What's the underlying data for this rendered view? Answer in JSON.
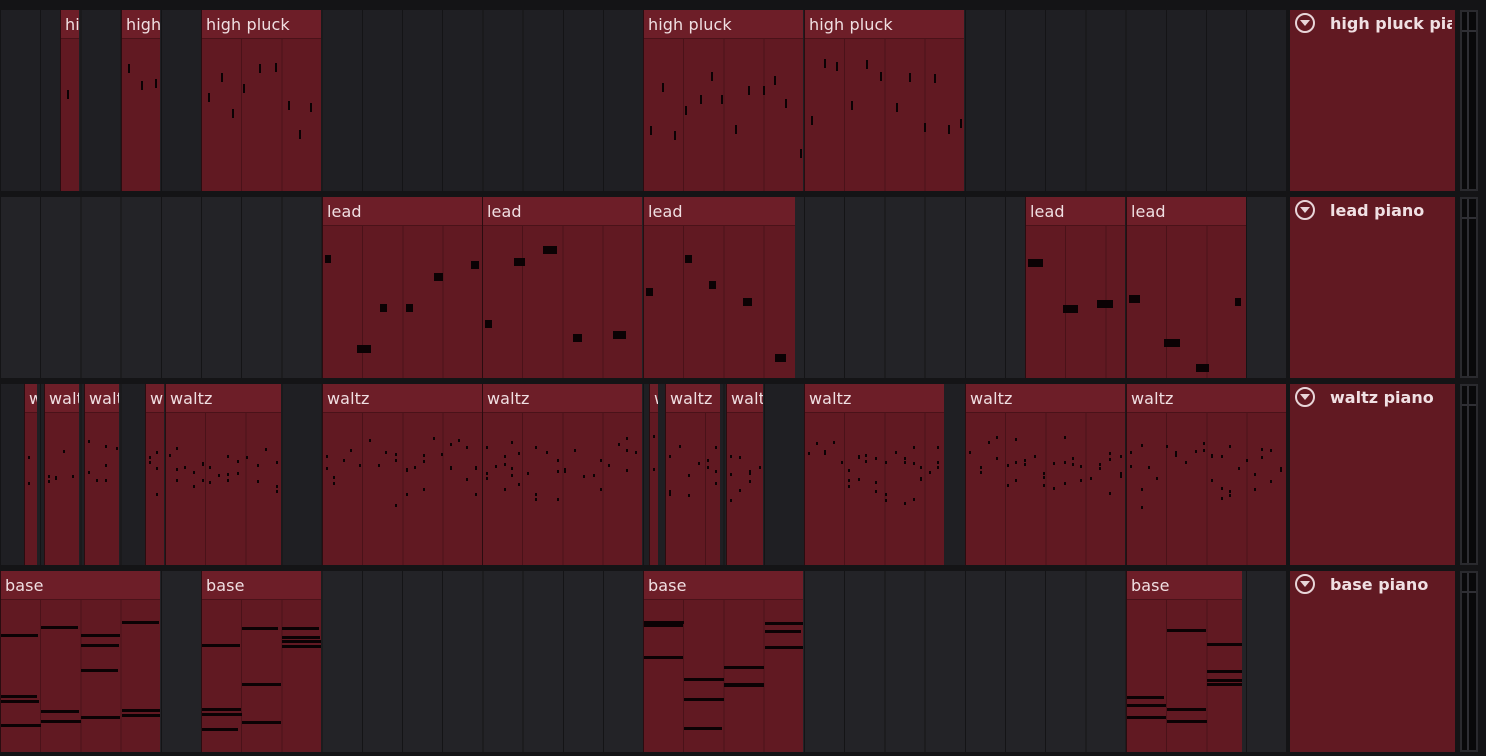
{
  "colors": {
    "clip": "#611922",
    "clip_header": "#6d1e28",
    "note": "#0b0204",
    "lane_bg": "#1f1f23",
    "gap": "#141416"
  },
  "tracks": [
    {
      "name": "high pluck piano",
      "header_icon": "chevron-down-circle-icon",
      "clips": [
        {
          "label": "high pluck",
          "start": 1.5,
          "end": 2.0
        },
        {
          "label": "high pluck",
          "start": 3.0,
          "end": 4.0
        },
        {
          "label": "high pluck",
          "start": 5.0,
          "end": 8.0
        },
        {
          "label": "high pluck",
          "start": 16.0,
          "end": 20.0
        },
        {
          "label": "high pluck",
          "start": 20.0,
          "end": 24.0
        }
      ]
    },
    {
      "name": "lead piano",
      "header_icon": "chevron-down-circle-icon",
      "clips": [
        {
          "label": "lead",
          "start": 8.0,
          "end": 12.0
        },
        {
          "label": "lead",
          "start": 12.0,
          "end": 16.0
        },
        {
          "label": "lead",
          "start": 16.0,
          "end": 19.8
        },
        {
          "label": "lead",
          "start": 25.5,
          "end": 28.0
        },
        {
          "label": "lead",
          "start": 28.0,
          "end": 31.0
        }
      ]
    },
    {
      "name": "waltz piano",
      "header_icon": "chevron-down-circle-icon",
      "clips": [
        {
          "label": "waltz",
          "start": 0.6,
          "end": 0.95
        },
        {
          "label": "waltz",
          "start": 1.1,
          "end": 2.0
        },
        {
          "label": "waltz",
          "start": 2.1,
          "end": 3.0
        },
        {
          "label": "waltz",
          "start": 3.6,
          "end": 4.1
        },
        {
          "label": "waltz",
          "start": 4.1,
          "end": 7.0
        },
        {
          "label": "waltz",
          "start": 8.0,
          "end": 12.0
        },
        {
          "label": "waltz",
          "start": 12.0,
          "end": 16.0
        },
        {
          "label": "waltz",
          "start": 16.15,
          "end": 16.4
        },
        {
          "label": "waltz",
          "start": 16.55,
          "end": 17.95
        },
        {
          "label": "waltz",
          "start": 18.05,
          "end": 19.0
        },
        {
          "label": "waltz",
          "start": 20.0,
          "end": 23.5
        },
        {
          "label": "waltz",
          "start": 24.0,
          "end": 28.0
        },
        {
          "label": "waltz",
          "start": 28.0,
          "end": 32.0
        }
      ]
    },
    {
      "name": "base piano",
      "header_icon": "chevron-down-circle-icon",
      "clips": [
        {
          "label": "base",
          "start": 0.0,
          "end": 4.0
        },
        {
          "label": "base",
          "start": 5.0,
          "end": 8.0
        },
        {
          "label": "base",
          "start": 16.0,
          "end": 20.0
        },
        {
          "label": "base",
          "start": 28.0,
          "end": 30.9
        }
      ]
    }
  ]
}
